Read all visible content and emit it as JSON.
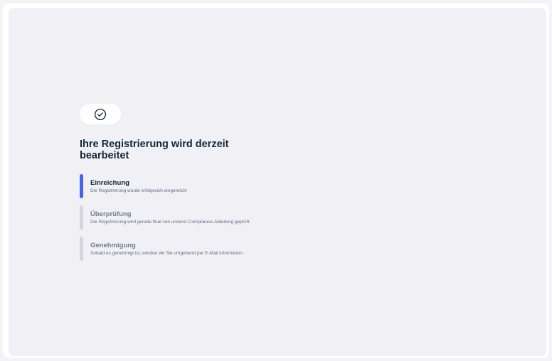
{
  "icons": {
    "status": "check-circle-icon"
  },
  "colors": {
    "accent": "#4b63e8",
    "inactive": "#d4d5de",
    "heading": "#0f2a3a",
    "muted": "#6e7d96"
  },
  "status": {
    "title": "Ihre Registrierung wird derzeit bearbeitet"
  },
  "steps": [
    {
      "title": "Einreichung",
      "description": "Die Registrierung wurde erfolgreich eingereicht",
      "state": "completed"
    },
    {
      "title": "Überprüfung",
      "description": "Die Registrierung wird gerade final von unserer Compliance-Abteilung geprüft.",
      "state": "pending"
    },
    {
      "title": "Genehmigung",
      "description": "Sobald es genehmigt ist, werden wir Sie umgehend per E-Mail informieren.",
      "state": "pending"
    }
  ]
}
